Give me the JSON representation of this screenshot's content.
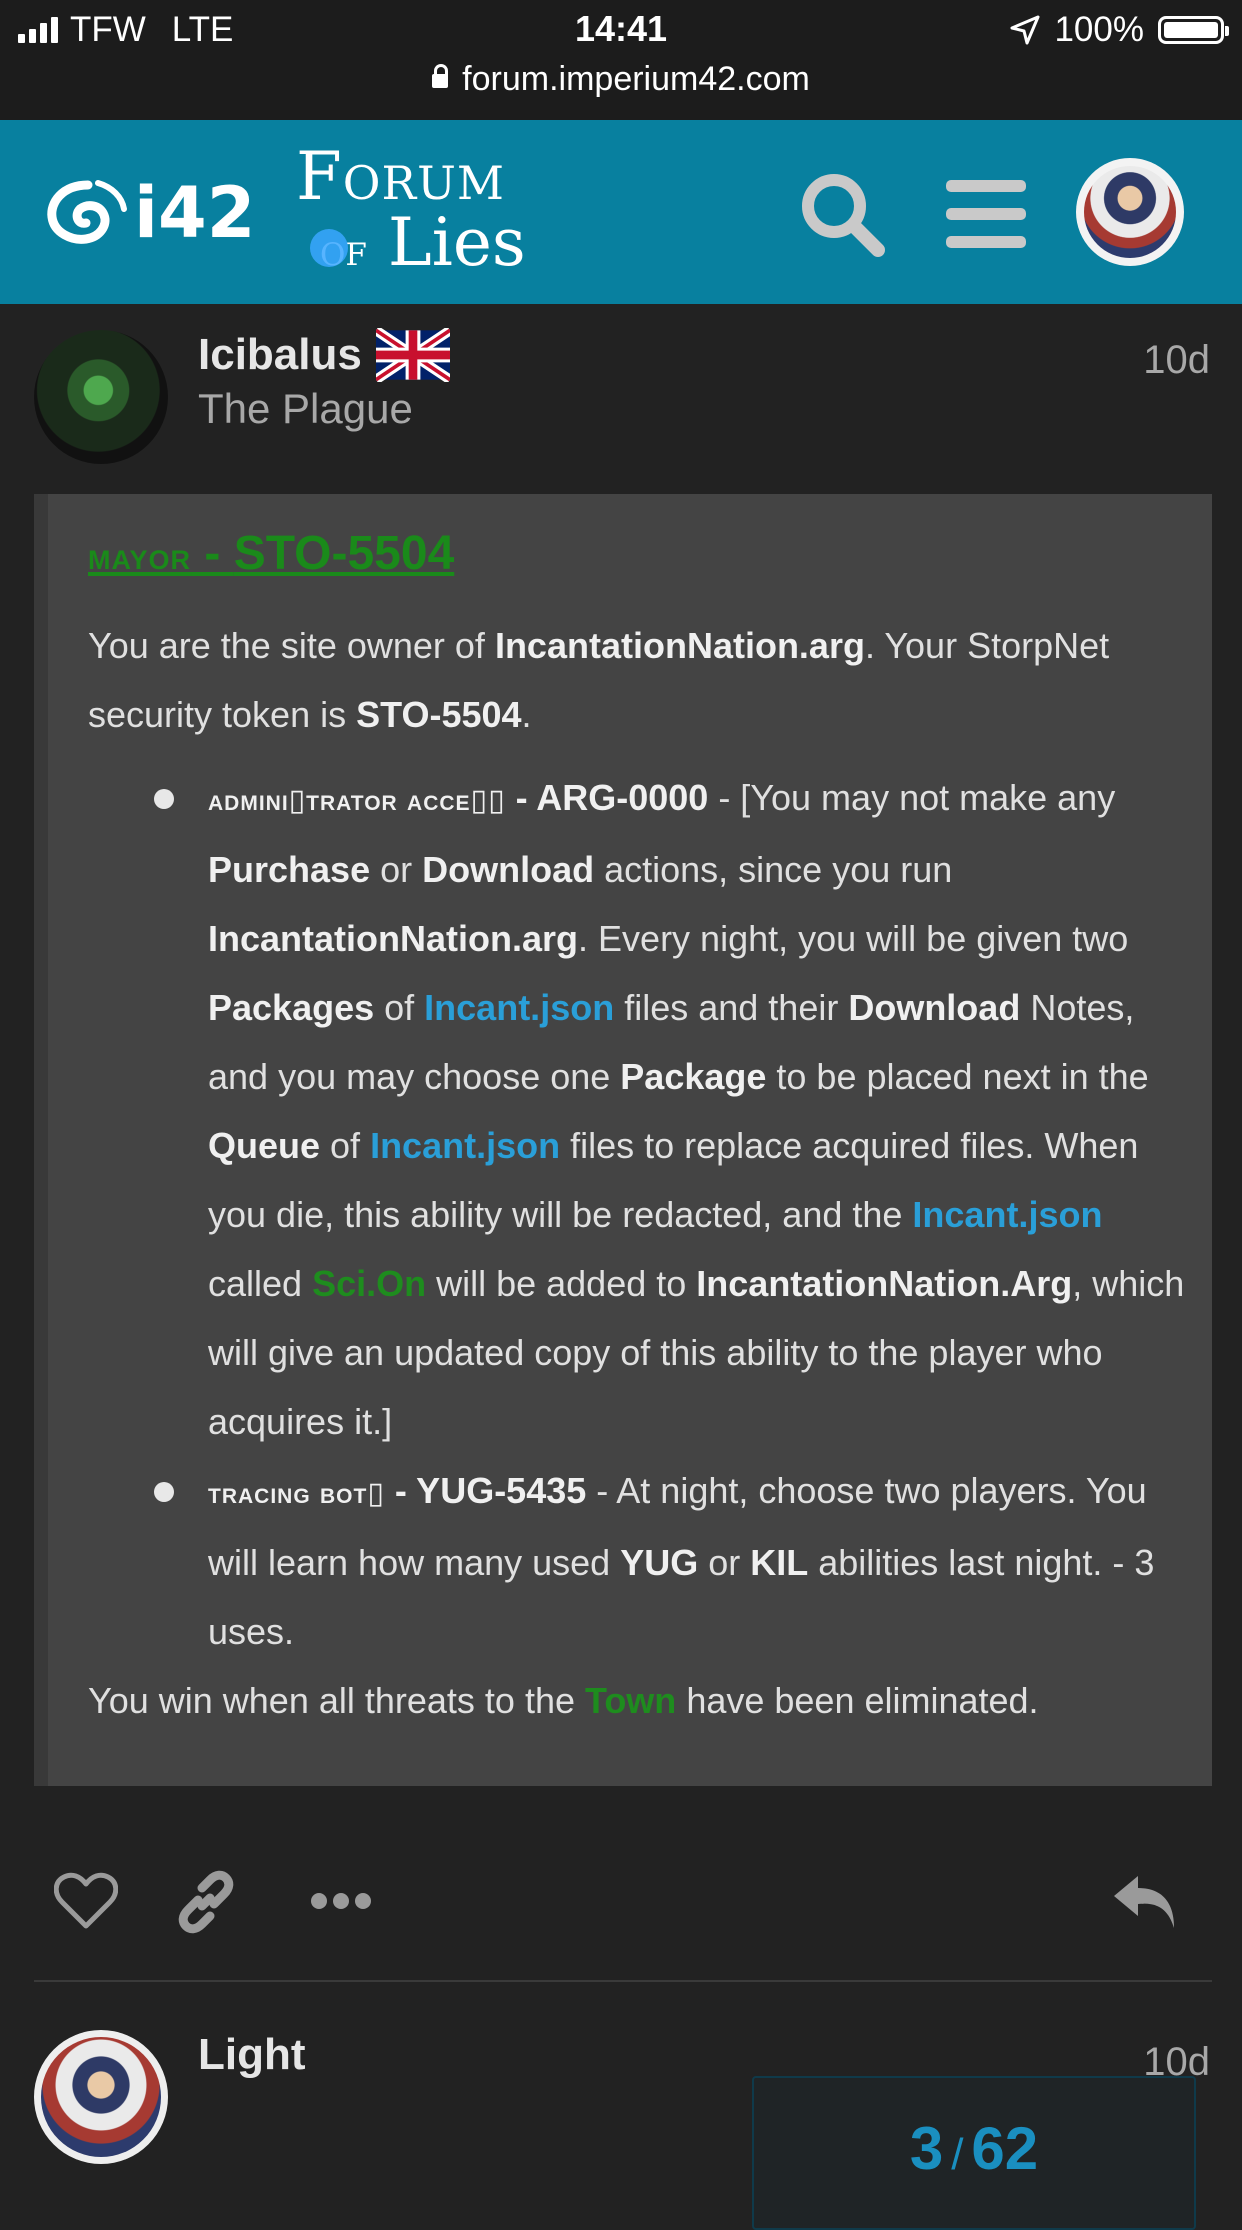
{
  "status_bar": {
    "carrier": "TFW",
    "network": "LTE",
    "time": "14:41",
    "battery": "100%",
    "url": "forum.imperium42.com"
  },
  "header": {
    "logo_text": "i42",
    "forum_title_line1": "Forum",
    "forum_title_of": "of",
    "forum_title_line2": "Lies",
    "avatar_badge": "LIGHT"
  },
  "post": {
    "username": "Icibalus",
    "user_title": "The Plague",
    "date": "10d",
    "heading_small": "mayor",
    "heading_sep": " - ",
    "heading_code": "STO-5504",
    "intro": {
      "t1": "You are the site owner of ",
      "site": "IncantationNation.arg",
      "t2": ". Your StorpNet security token is ",
      "token": "STO-5504",
      "t3": "."
    },
    "ability1": {
      "name": "admini▯trator acce▯▯",
      "code": " - ARG-0000",
      "t1": " - [You may not make any ",
      "purchase": "Purchase",
      "t2": " or ",
      "download": "Download",
      "t3": " actions, since you run ",
      "site": "IncantationNation.arg",
      "t4": ". Every night, you will be given two ",
      "packages": "Packages",
      "t5": " of ",
      "incant1": "Incant.json",
      "t6": " files and their ",
      "download2": "Download",
      "t7": " Notes, and you may choose one ",
      "package": "Package",
      "t8": " to be placed next in the ",
      "queue": "Queue",
      "t9": " of ",
      "incant2": "Incant.json",
      "t10": " files to replace acquired files. When you die, this ability will be redacted, and the ",
      "incant3": "Incant.json",
      "t11": " called ",
      "scion": "Sci.On",
      "t12": " will be added to ",
      "site2": "IncantationNation.Arg",
      "t13": ", which will give an updated copy of this ability to the player who acquires it.]"
    },
    "ability2": {
      "name": "tracing bot▯",
      "code": " - YUG-5435",
      "t1": " - At night, choose two players. You will learn how many used ",
      "yug": "YUG",
      "t2": " or ",
      "kil": "KIL",
      "t3": " abilities last night. - 3 uses."
    },
    "win": {
      "t1": "You win when all threats to the ",
      "town": "Town",
      "t2": " have been eliminated."
    }
  },
  "next_post": {
    "username": "Light",
    "date": "10d"
  },
  "progress": {
    "current": "3",
    "total": "62"
  },
  "colors": {
    "header_bg": "#08809f",
    "page_bg": "#222222",
    "post_bg": "#444444",
    "link_blue": "#2a9fd8",
    "green": "#1e8c1e"
  },
  "icons": [
    "signal-icon",
    "location-arrow-icon",
    "battery-icon",
    "lock-icon",
    "search-icon",
    "hamburger-menu-icon",
    "heart-icon",
    "link-icon",
    "more-icon",
    "reply-icon",
    "uk-flag-icon"
  ]
}
